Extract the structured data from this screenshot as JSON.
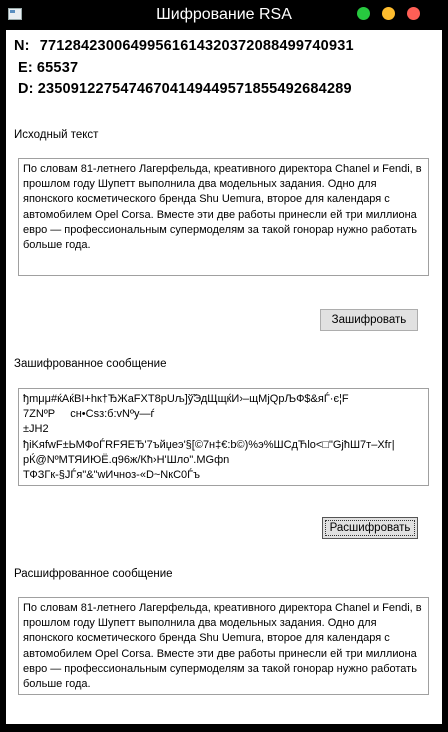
{
  "window": {
    "title": "Шифрование RSA"
  },
  "keys": {
    "n_label": "N:",
    "n_value": "7712842300649956161432037208849974093​1",
    "e_label": "E:",
    "e_value": "65537",
    "d_label": "D:",
    "d_value": "2350912275474670414944957185549268428​9"
  },
  "source": {
    "label": "Исходный текст",
    "text": "По словам 81-летнего Лагерфельда, креативного директора Chanel и Fendi, в прошлом году Шупетт выполнила два модельных задания. Одно для японского косметического бренда Shu Uemura, второе для календаря с автомобилем Opel Corsa. Вместе эти две работы принесли ей три миллиона евро — профессиональным супермоделям за такой гонорар нужно работать больше года."
  },
  "encrypt_button": {
    "label": "Зашифровать"
  },
  "encrypted": {
    "label": "Зашифрованное сообщение",
    "text": "ђmμμ#ќAќBI+hк†ЂЖаFXT8рUљ]ў̃ЭдЩщќИ›–щМјQрЉФ$&яЃ·є¦F\n7ZNºP     сн•Csз:б:vNºy—ѓ\n±JH2\nђiKяfwF±ЬМФоЃRFЯЕЂ'7ъйџеэ'§[©7н‡€:b©)%э%ШСдЋlо<□\"GјћШ7т–Хfг|\nрЌ@NºМТЯИЮЁ.q96ж/Кћ›Н'Шло\".MGфn\nТФЗГк-§ЈЃя\"&\"wИчноз-«D~NкC0Ѓъ"
  },
  "decrypt_button": {
    "label": "Расшифровать"
  },
  "decrypted": {
    "label": "Расшифрованное сообщение",
    "text": "По словам 81-летнего Лагерфельда, креативного директора Chanel и Fendi, в прошлом году Шупетт выполнила два модельных задания. Одно для японского косметического бренда Shu Uemura, второе для календаря с автомобилем Opel Corsa. Вместе эти две работы принесли ей три миллиона евро — профессиональным супермоделям за такой гонорар нужно работать больше года."
  },
  "icons": {
    "app": "window-app-icon",
    "minimize": "green-circle",
    "maximize": "yellow-circle",
    "close": "red-circle"
  },
  "colors": {
    "titlebar_bg": "#000000",
    "minimize": "#27c93f",
    "maximize": "#ffbd2e",
    "close": "#ff5f56"
  }
}
